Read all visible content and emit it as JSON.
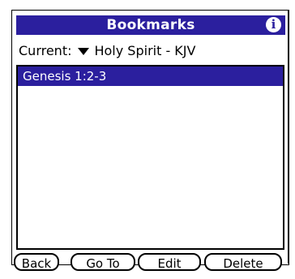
{
  "header": {
    "title": "Bookmarks",
    "info_icon": "i"
  },
  "current": {
    "label": "Current:",
    "value": "Holy Spirit - KJV"
  },
  "bookmarks": [
    {
      "label": "Genesis 1:2-3",
      "selected": true
    }
  ],
  "buttons": {
    "back": "Back",
    "goto": "Go To",
    "edit": "Edit",
    "delete": "Delete"
  },
  "colors": {
    "accent": "#2b1f9e"
  }
}
